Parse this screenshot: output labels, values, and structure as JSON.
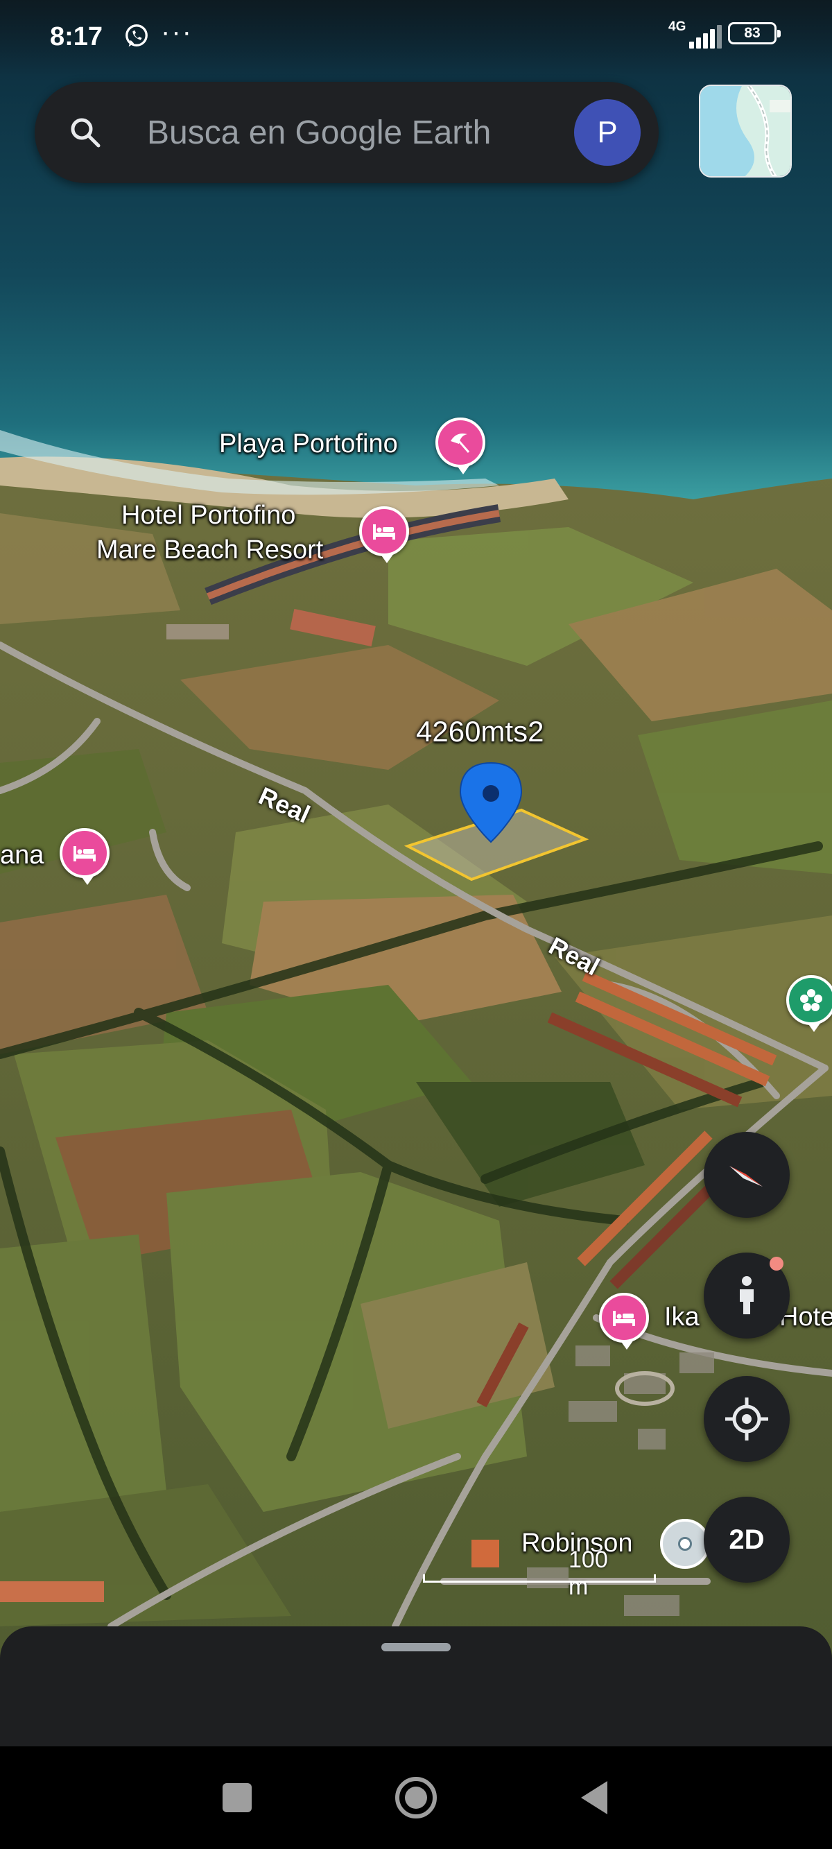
{
  "status_bar": {
    "time": "8:17",
    "network": "4G",
    "battery": "83",
    "icons": [
      "whatsapp-icon",
      "more-dots-icon",
      "signal-icon",
      "battery-icon"
    ]
  },
  "search": {
    "placeholder": "Busca en Google Earth",
    "avatar_initial": "P"
  },
  "map": {
    "places": {
      "playa": "Playa Portofino",
      "hotel_line1": "Hotel Portofino",
      "hotel_line2": "Mare Beach Resort",
      "left_partial": "ana",
      "ikaros_partial": "Ika",
      "ikaros_tail": "Hote",
      "robinson": "Robinson"
    },
    "roads": {
      "real_1": "Real",
      "real_2": "Real"
    },
    "measurement": "4260mts2",
    "scale": "100 m"
  },
  "controls": {
    "compass": "compass-icon",
    "street_view": "pegman-icon",
    "my_location": "my-location-icon",
    "view_mode": "2D"
  },
  "colors": {
    "pin_pink": "#ea4b9c",
    "pin_green": "#1e9c6a",
    "location_pin_blue": "#1a73e8",
    "polygon_outline": "#f2c530",
    "ui_dark": "#1f2124"
  }
}
